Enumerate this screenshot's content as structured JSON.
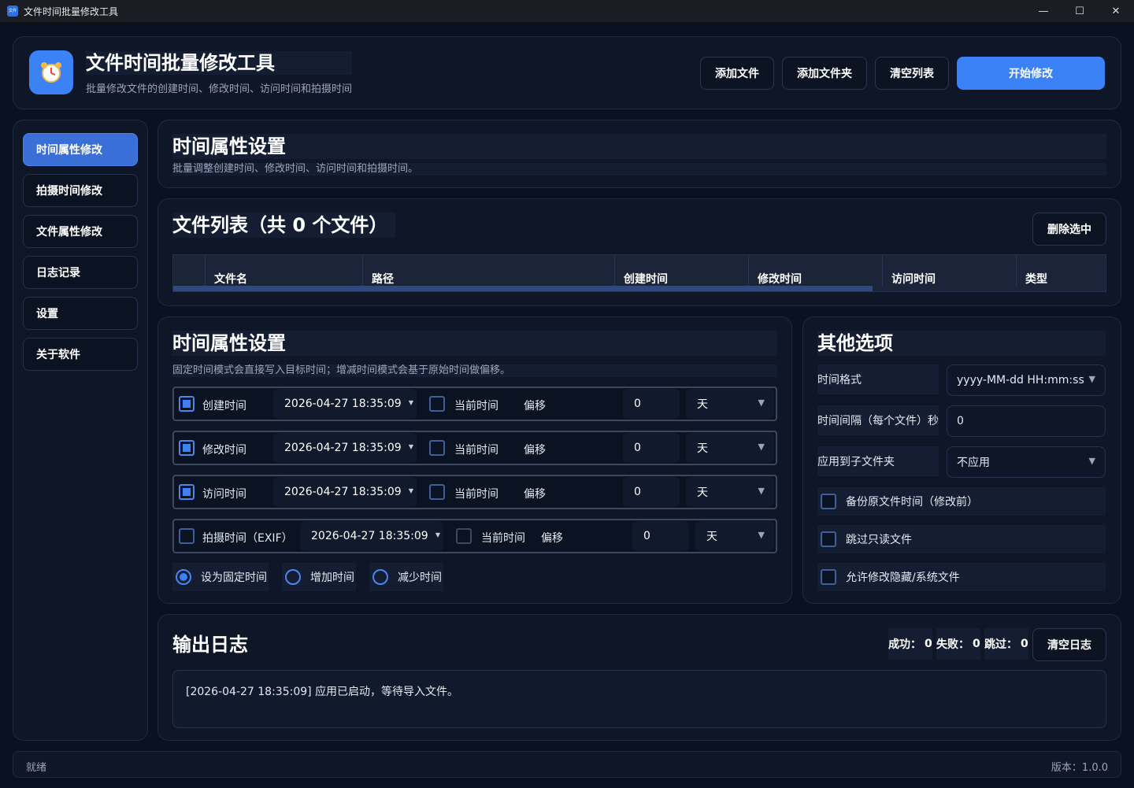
{
  "window": {
    "title": "文件时间批量修改工具",
    "icon_text": "文件"
  },
  "header": {
    "title": "文件时间批量修改工具",
    "subtitle": "批量修改文件的创建时间、修改时间、访问时间和拍摄时间",
    "buttons": {
      "add_file": "添加文件",
      "add_folder": "添加文件夹",
      "clear_list": "清空列表",
      "start": "开始修改"
    }
  },
  "sidebar": {
    "items": [
      {
        "label": "时间属性修改",
        "active": true
      },
      {
        "label": "拍摄时间修改"
      },
      {
        "label": "文件属性修改"
      },
      {
        "label": "日志记录"
      },
      {
        "label": "设置"
      },
      {
        "label": "关于软件"
      }
    ]
  },
  "top_section": {
    "title": "时间属性设置",
    "subtitle": "批量调整创建时间、修改时间、访问时间和拍摄时间。"
  },
  "file_list": {
    "title": "文件列表（共 0 个文件）",
    "delete_selected": "删除选中",
    "columns": [
      "文件名",
      "路径",
      "创建时间",
      "修改时间",
      "访问时间",
      "类型"
    ]
  },
  "time_settings": {
    "title": "时间属性设置",
    "subtitle": "固定时间模式会直接写入目标时间；增减时间模式会基于原始时间做偏移。",
    "rows": [
      {
        "label": "创建时间",
        "checked": true,
        "datetime": "2026-04-27 18:35:09",
        "current_label": "当前时间",
        "offset_label": "偏移",
        "offset": "0",
        "unit": "天"
      },
      {
        "label": "修改时间",
        "checked": true,
        "datetime": "2026-04-27 18:35:09",
        "current_label": "当前时间",
        "offset_label": "偏移",
        "offset": "0",
        "unit": "天"
      },
      {
        "label": "访问时间",
        "checked": true,
        "datetime": "2026-04-27 18:35:09",
        "current_label": "当前时间",
        "offset_label": "偏移",
        "offset": "0",
        "unit": "天"
      },
      {
        "label": "拍摄时间（EXIF）",
        "checked": false,
        "datetime": "2026-04-27 18:35:09",
        "current_label": "当前时间",
        "offset_label": "偏移",
        "offset": "0",
        "unit": "天"
      }
    ],
    "modes": [
      {
        "label": "设为固定时间",
        "selected": true
      },
      {
        "label": "增加时间",
        "selected": false
      },
      {
        "label": "减少时间",
        "selected": false
      }
    ]
  },
  "other_options": {
    "title": "其他选项",
    "time_format_label": "时间格式",
    "time_format_value": "yyyy-MM-dd HH:mm:ss",
    "interval_label": "时间间隔（每个文件）秒",
    "interval_value": "0",
    "apply_sub_label": "应用到子文件夹",
    "apply_sub_value": "不应用",
    "checks": [
      {
        "label": "备份原文件时间（修改前）",
        "checked": false
      },
      {
        "label": "跳过只读文件",
        "checked": false
      },
      {
        "label": "允许修改隐藏/系统文件",
        "checked": false
      }
    ]
  },
  "log": {
    "title": "输出日志",
    "success_label": "成功：",
    "success": "0",
    "fail_label": "失败：",
    "fail": "0",
    "skip_label": "跳过：",
    "skip": "0",
    "clear": "清空日志",
    "text": "[2026-04-27 18:35:09] 应用已启动，等待导入文件。"
  },
  "status": {
    "left": "就绪",
    "version": "版本：1.0.0"
  },
  "colors": {
    "accent": "#3b82f6",
    "background": "#0a1120",
    "panel": "#0e1628"
  }
}
